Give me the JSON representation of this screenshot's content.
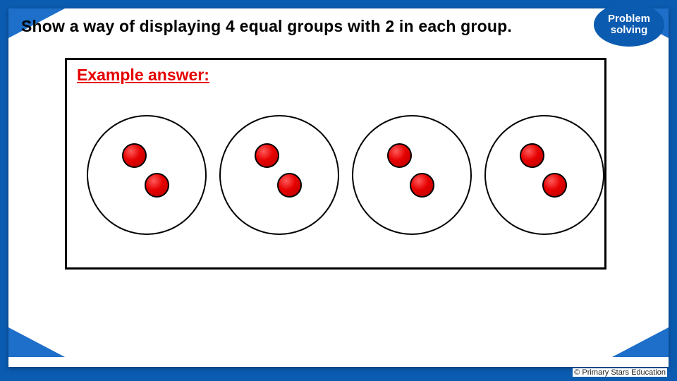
{
  "badge": {
    "line1": "Problem",
    "line2": "solving"
  },
  "prompt": "Show a way of displaying 4 equal groups with 2 in each group.",
  "answer_label": "Example answer:",
  "diagram": {
    "groups": 4,
    "items_per_group": 2,
    "item_color": "#e60000"
  },
  "attribution": "© Primary Stars Education"
}
